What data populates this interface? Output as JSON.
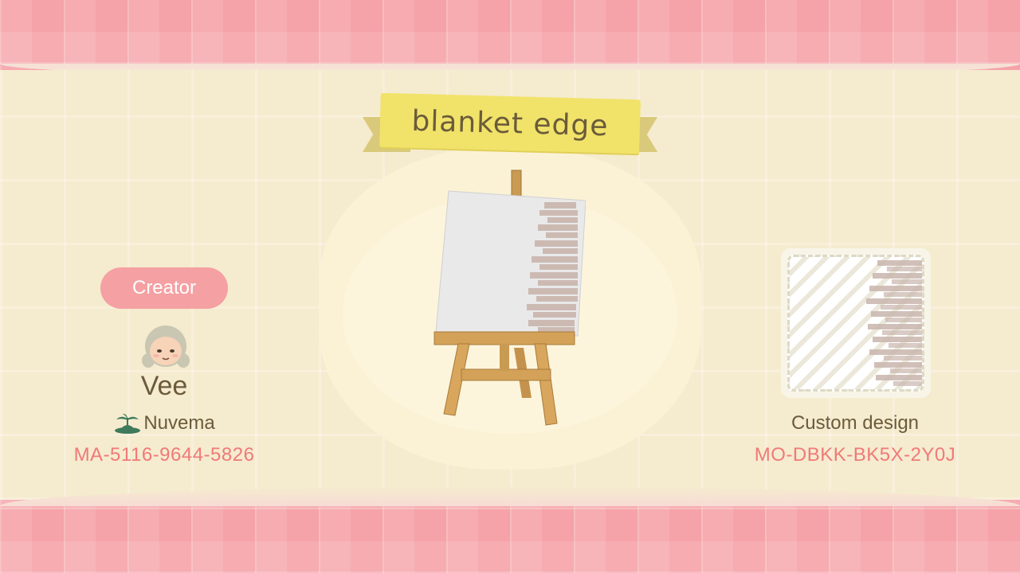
{
  "design": {
    "title": "blanket edge",
    "type_label": "Custom design",
    "design_code": "MO-DBKK-BK5X-2Y0J"
  },
  "creator": {
    "label": "Creator",
    "name": "Vee",
    "island": "Nuvema",
    "creator_id": "MA-5116-9644-5826"
  },
  "icons": {
    "island": "palm-tree-island-icon",
    "avatar": "villager-avatar-icon"
  },
  "colors": {
    "accent_pink": "#f5a0a3",
    "code_text": "#ef7a78",
    "banner_yellow": "#f1e36a",
    "text_brown": "#6b5b3a"
  }
}
